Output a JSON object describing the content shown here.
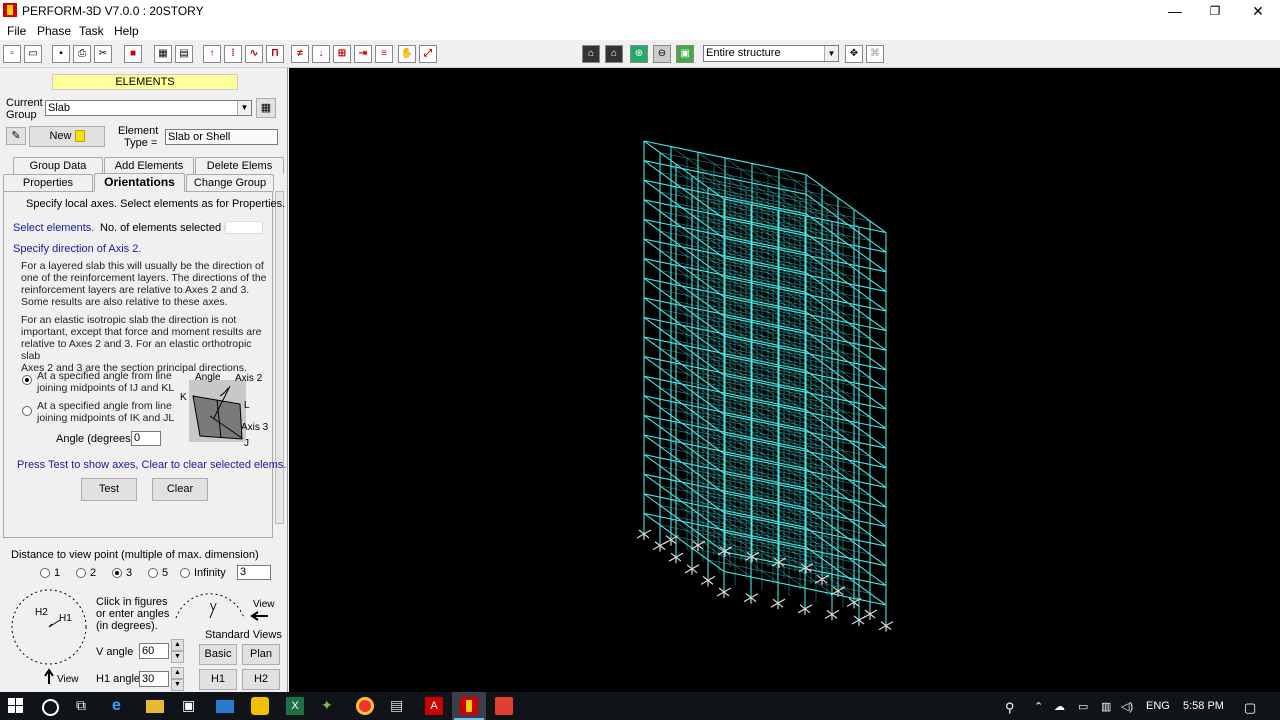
{
  "window": {
    "title": "PERFORM-3D V7.0.0 : 20STORY",
    "controls": [
      "—",
      "❐",
      "✕"
    ]
  },
  "menu": [
    "File",
    "Phase",
    "Task",
    "Help"
  ],
  "toolbar": {
    "view_select": "Entire structure"
  },
  "panel": {
    "header": "ELEMENTS",
    "current_group_label": [
      "Current",
      "Group"
    ],
    "current_group_value": "Slab",
    "new_button": "New",
    "element_type_label": [
      "Element",
      "Type ="
    ],
    "element_type_value": "Slab or Shell",
    "tabs_row1": [
      "Group Data",
      "Add Elements",
      "Delete Elems"
    ],
    "tabs_row2": [
      "Properties",
      "Orientations",
      "Change Group"
    ],
    "active_tab": "Orientations",
    "intro": "Specify local axes. Select elements as for Properties.",
    "select_elements": "Select elements.",
    "no_selected_label": "No. of elements selected =",
    "no_selected_value": "",
    "specify_axis2": "Specify direction of Axis 2.",
    "para1": [
      "For a layered slab this will usually be the direction of",
      "one of the reinforcement layers. The directions of the",
      "reinforcement layers are relative to Axes 2 and 3.",
      "Some results are also relative to these axes."
    ],
    "para2": [
      "For an elastic isotropic slab the direction is not",
      "important, except that force and moment results are",
      "relative to Axes 2 and 3. For an elastic orthotropic slab",
      "Axes 2 and 3 are the section principal directions."
    ],
    "option1": [
      "At a specified angle from line",
      "joining midpoints of IJ and KL"
    ],
    "option2": [
      "At a specified angle from line",
      "joining midpoints of IK and JL"
    ],
    "angle_label": "Angle (degrees)",
    "angle_value": "0",
    "diagram_labels": {
      "angle": "Angle",
      "axis2": "Axis 2",
      "axis3": "Axis 3",
      "k": "K",
      "l": "L",
      "j": "J"
    },
    "press_test": "Press Test to show axes, Clear to clear selected elems.",
    "test_button": "Test",
    "clear_button": "Clear"
  },
  "view": {
    "distance_label": "Distance to view point (multiple of max. dimension)",
    "distance_options": [
      "1",
      "2",
      "3",
      "5",
      "Infinity"
    ],
    "distance_selected": "3",
    "distance_value": "3",
    "click_hint": [
      "Click in figures",
      "or enter angles",
      "(in degrees)."
    ],
    "h2": "H2",
    "h1": "H1",
    "v": "V",
    "view_label": "View",
    "v_angle_label": "V angle",
    "v_angle_value": "60",
    "h1_angle_label": "H1 angle",
    "h1_angle_value": "30",
    "standard_views": "Standard Views",
    "basic": "Basic",
    "plan": "Plan",
    "h1_btn": "H1",
    "h2_btn": "H2"
  },
  "colors": {
    "frame": "#44e6e6",
    "support": "#d8d8d8",
    "canvas_bg": "#000000"
  },
  "tray": {
    "lang": "ENG",
    "time": "5:58 PM"
  }
}
